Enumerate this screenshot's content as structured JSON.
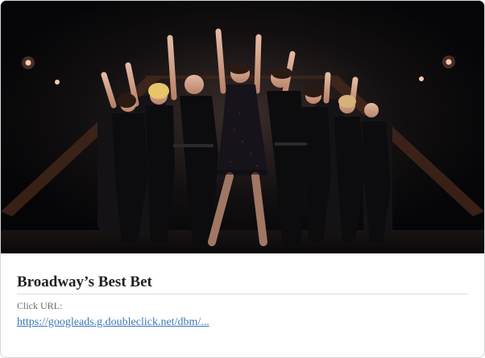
{
  "ad": {
    "title": "Broadway’s Best Bet",
    "click_url_label": "Click URL:",
    "click_url": "https://googleads.g.doubleclick.net/dbm/..."
  },
  "hero": {
    "description_icon": "stage-performance-photo",
    "background": "#07070a"
  },
  "colors": {
    "link": "#3a76b8",
    "title": "#1f2326",
    "label": "#6d6d6d",
    "divider": "#dcdcdc",
    "border": "#d6d6d6"
  }
}
